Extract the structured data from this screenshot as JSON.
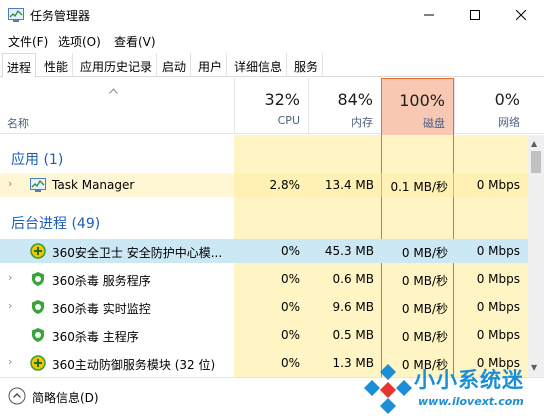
{
  "window": {
    "title": "任务管理器"
  },
  "menu": [
    "文件(F)",
    "选项(O)",
    "查看(V)"
  ],
  "tabs": [
    "进程",
    "性能",
    "应用历史记录",
    "启动",
    "用户",
    "详细信息",
    "服务"
  ],
  "active_tab": "进程",
  "columns": {
    "name": "名称",
    "cpu": {
      "pct": "32%",
      "label": "CPU"
    },
    "mem": {
      "pct": "84%",
      "label": "内存"
    },
    "disk": {
      "pct": "100%",
      "label": "磁盘"
    },
    "net": {
      "pct": "0%",
      "label": "网络"
    }
  },
  "sections": {
    "apps": "应用 (1)",
    "background": "后台进程 (49)"
  },
  "rows": [
    {
      "name": "Task Manager",
      "cpu": "2.8%",
      "mem": "13.4 MB",
      "disk": "0.1 MB/秒",
      "net": "0 Mbps"
    },
    {
      "name": "360安全卫士 安全防护中心模...",
      "cpu": "0%",
      "mem": "45.3 MB",
      "disk": "0 MB/秒",
      "net": "0 Mbps"
    },
    {
      "name": "360杀毒 服务程序",
      "cpu": "0%",
      "mem": "0.6 MB",
      "disk": "0 MB/秒",
      "net": "0 Mbps"
    },
    {
      "name": "360杀毒 实时监控",
      "cpu": "0%",
      "mem": "9.6 MB",
      "disk": "0 MB/秒",
      "net": "0 Mbps"
    },
    {
      "name": "360杀毒 主程序",
      "cpu": "0%",
      "mem": "0.5 MB",
      "disk": "0 MB/秒",
      "net": "0 Mbps"
    },
    {
      "name": "360主动防御服务模块 (32 位)",
      "cpu": "0%",
      "mem": "1.3 MB",
      "disk": "0 MB/秒",
      "net": "0 Mbps"
    }
  ],
  "footer": {
    "label": "简略信息(D)"
  },
  "watermark": {
    "title": "小小系统迷",
    "url": "www.ilovext.com"
  },
  "colors": {
    "accent_blue": "#1c5db8",
    "heat_light": "#fff4c4",
    "disk_header": "#f8c8b3",
    "disk_border": "#e86c34",
    "selected": "#cce8f4"
  }
}
